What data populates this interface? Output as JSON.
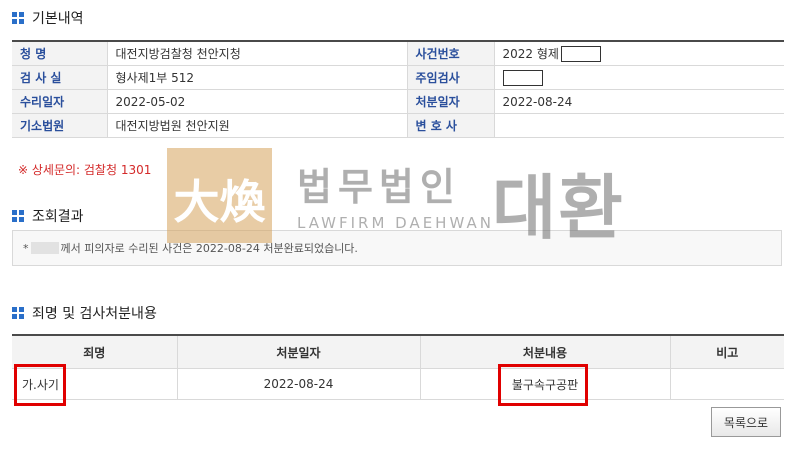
{
  "sections": {
    "basic_title": "기본내역",
    "result_title": "조회결과",
    "detail_title": "죄명 및 검사처분내용"
  },
  "basic": {
    "rows": [
      {
        "l1": "청    명",
        "v1": "대전지방검찰청 천안지청",
        "l2": "사건번호",
        "v2": "2022 형제"
      },
      {
        "l1": "검 사 실",
        "v1": "형사제1부 512",
        "l2": "주임검사",
        "v2": ""
      },
      {
        "l1": "수리일자",
        "v1": "2022-05-02",
        "l2": "처분일자",
        "v2": "2022-08-24"
      },
      {
        "l1": "기소법원",
        "v1": "대전지방법원 천안지원",
        "l2": "변 호 사",
        "v2": ""
      }
    ]
  },
  "note": "※ 상세문의: 검찰청 1301",
  "result": {
    "bullet": "*",
    "text": "께서 피의자로 수리된 사건은 2022-08-24 처분완료되었습니다."
  },
  "detail": {
    "headers": [
      "죄명",
      "처분일자",
      "처분내용",
      "비고"
    ],
    "rows": [
      {
        "charge": "가.사기",
        "date": "2022-08-24",
        "disposition": "불구속구공판",
        "remark": ""
      }
    ]
  },
  "buttons": {
    "list": "목록으로"
  },
  "watermark": {
    "logo_text": "大煥",
    "korean": "법무법인",
    "english": "LAWFIRM DAEHWAN",
    "big": "대환"
  },
  "colors": {
    "accent": "#2a6fc9",
    "label": "#2a4f9c",
    "highlight": "#e00000",
    "note": "#d42a2a"
  }
}
